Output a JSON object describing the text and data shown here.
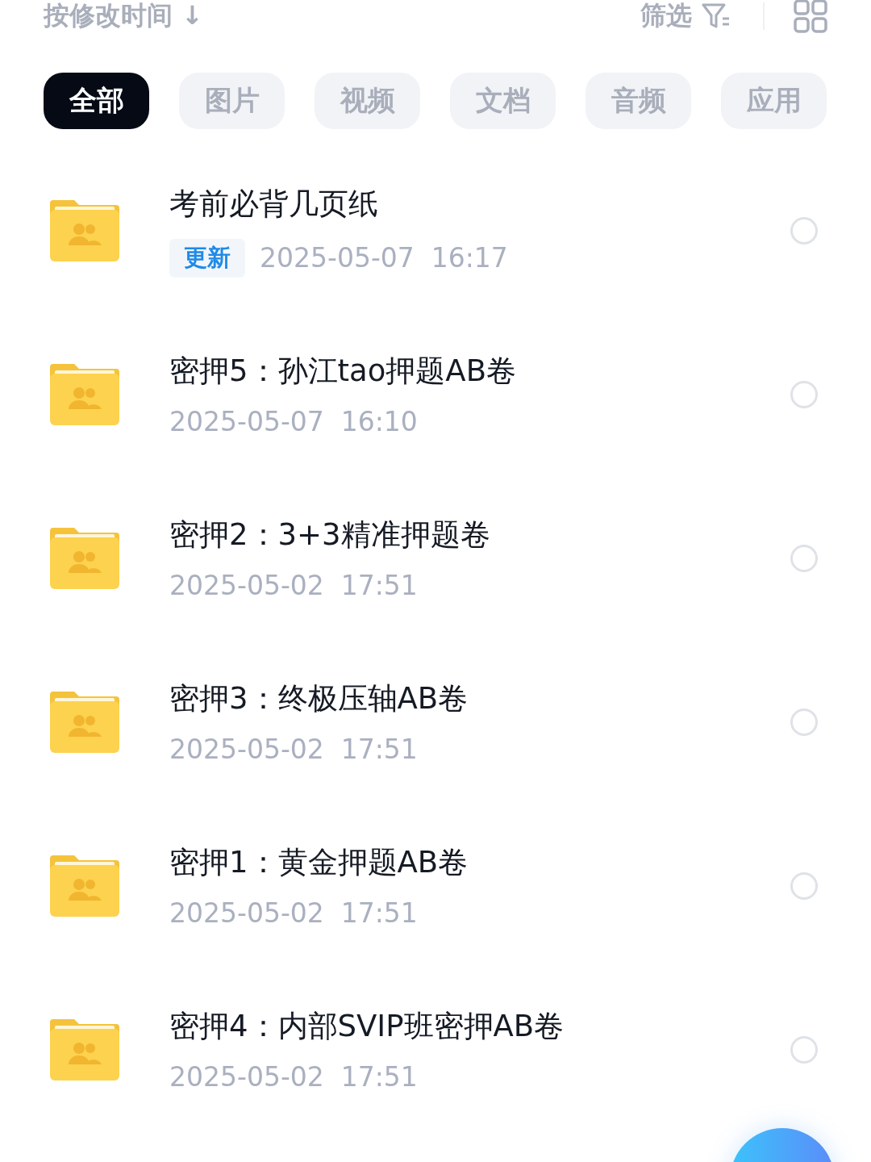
{
  "sort": {
    "label": "按修改时间",
    "arrow": "↓"
  },
  "filter": {
    "label": "筛选"
  },
  "tabs": [
    {
      "label": "全部",
      "selected": true
    },
    {
      "label": "图片",
      "selected": false
    },
    {
      "label": "视频",
      "selected": false
    },
    {
      "label": "文档",
      "selected": false
    },
    {
      "label": "音频",
      "selected": false
    },
    {
      "label": "应用",
      "selected": false
    }
  ],
  "files": [
    {
      "name": "考前必背几页纸",
      "badge": "更新",
      "date": "2025-05-07",
      "time": "16:17",
      "selected": false
    },
    {
      "name": "密押5：孙江tao押题AB卷",
      "date": "2025-05-07",
      "time": "16:10",
      "selected": false
    },
    {
      "name": "密押2：3+3精准押题卷",
      "date": "2025-05-02",
      "time": "17:51",
      "selected": false
    },
    {
      "name": "密押3：终极压轴AB卷",
      "date": "2025-05-02",
      "time": "17:51",
      "selected": false
    },
    {
      "name": "密押1：黄金押题AB卷",
      "date": "2025-05-02",
      "time": "17:51",
      "selected": false
    },
    {
      "name": "密押4：内部SVIP班密押AB卷",
      "date": "2025-05-02",
      "time": "17:51",
      "selected": false
    }
  ]
}
